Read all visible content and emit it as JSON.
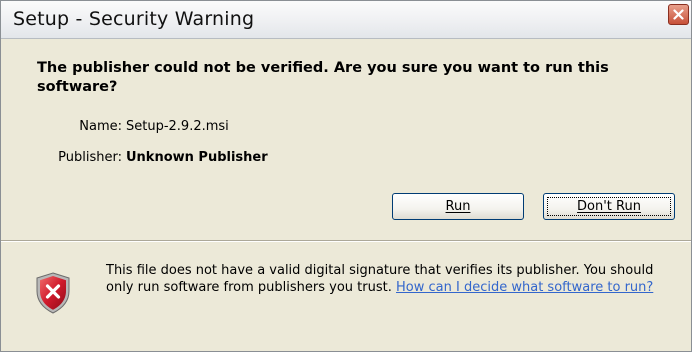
{
  "window": {
    "title": "Setup - Security Warning"
  },
  "main": {
    "question": "The publisher could not be verified.  Are you sure you want to run this software?",
    "name_label": "Name:",
    "name_value": "Setup-2.9.2.msi",
    "publisher_label": "Publisher:",
    "publisher_value": "Unknown Publisher"
  },
  "buttons": {
    "run_label": "Run",
    "dont_run_label": "Don't Run"
  },
  "footer": {
    "message": "This file does not have a valid digital signature that verifies its publisher. You should only run software from publishers you trust.",
    "help_link": "How can I decide what software to run?"
  },
  "icons": {
    "close": "close-icon",
    "shield": "security-shield-icon"
  },
  "colors": {
    "dialog_bg": "#ece9d8",
    "link": "#3366cc",
    "shield_red": "#c8142b",
    "close_red": "#c75038"
  }
}
